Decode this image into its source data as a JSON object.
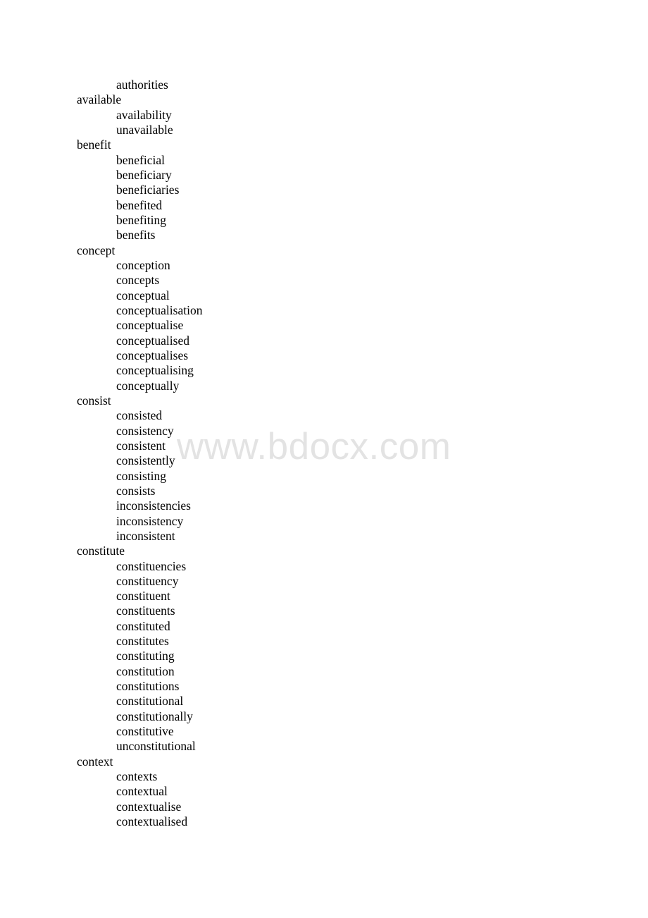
{
  "document": {
    "leading_subitems": [
      "authorities"
    ],
    "entries": [
      {
        "head": "available",
        "forms": [
          "availability",
          "unavailable"
        ]
      },
      {
        "head": "benefit",
        "forms": [
          "beneficial",
          "beneficiary",
          "beneficiaries",
          "benefited",
          "benefiting",
          "benefits"
        ]
      },
      {
        "head": "concept",
        "forms": [
          "conception",
          "concepts",
          "conceptual",
          "conceptualisation",
          "conceptualise",
          "conceptualised",
          "conceptualises",
          "conceptualising",
          "conceptually"
        ]
      },
      {
        "head": "consist",
        "forms": [
          "consisted",
          "consistency",
          "consistent",
          "consistently",
          "consisting",
          "consists",
          "inconsistencies",
          "inconsistency",
          "inconsistent"
        ]
      },
      {
        "head": "constitute",
        "forms": [
          "constituencies",
          "constituency",
          "constituent",
          "constituents",
          "constituted",
          "constitutes",
          "constituting",
          "constitution",
          "constitutions",
          "constitutional",
          "constitutionally",
          "constitutive",
          "unconstitutional"
        ]
      },
      {
        "head": "context",
        "forms": [
          "contexts",
          "contextual",
          "contextualise",
          "contextualised"
        ]
      }
    ]
  },
  "watermark": {
    "text": "www.bdocx.com",
    "color": "#e3e3e3"
  }
}
